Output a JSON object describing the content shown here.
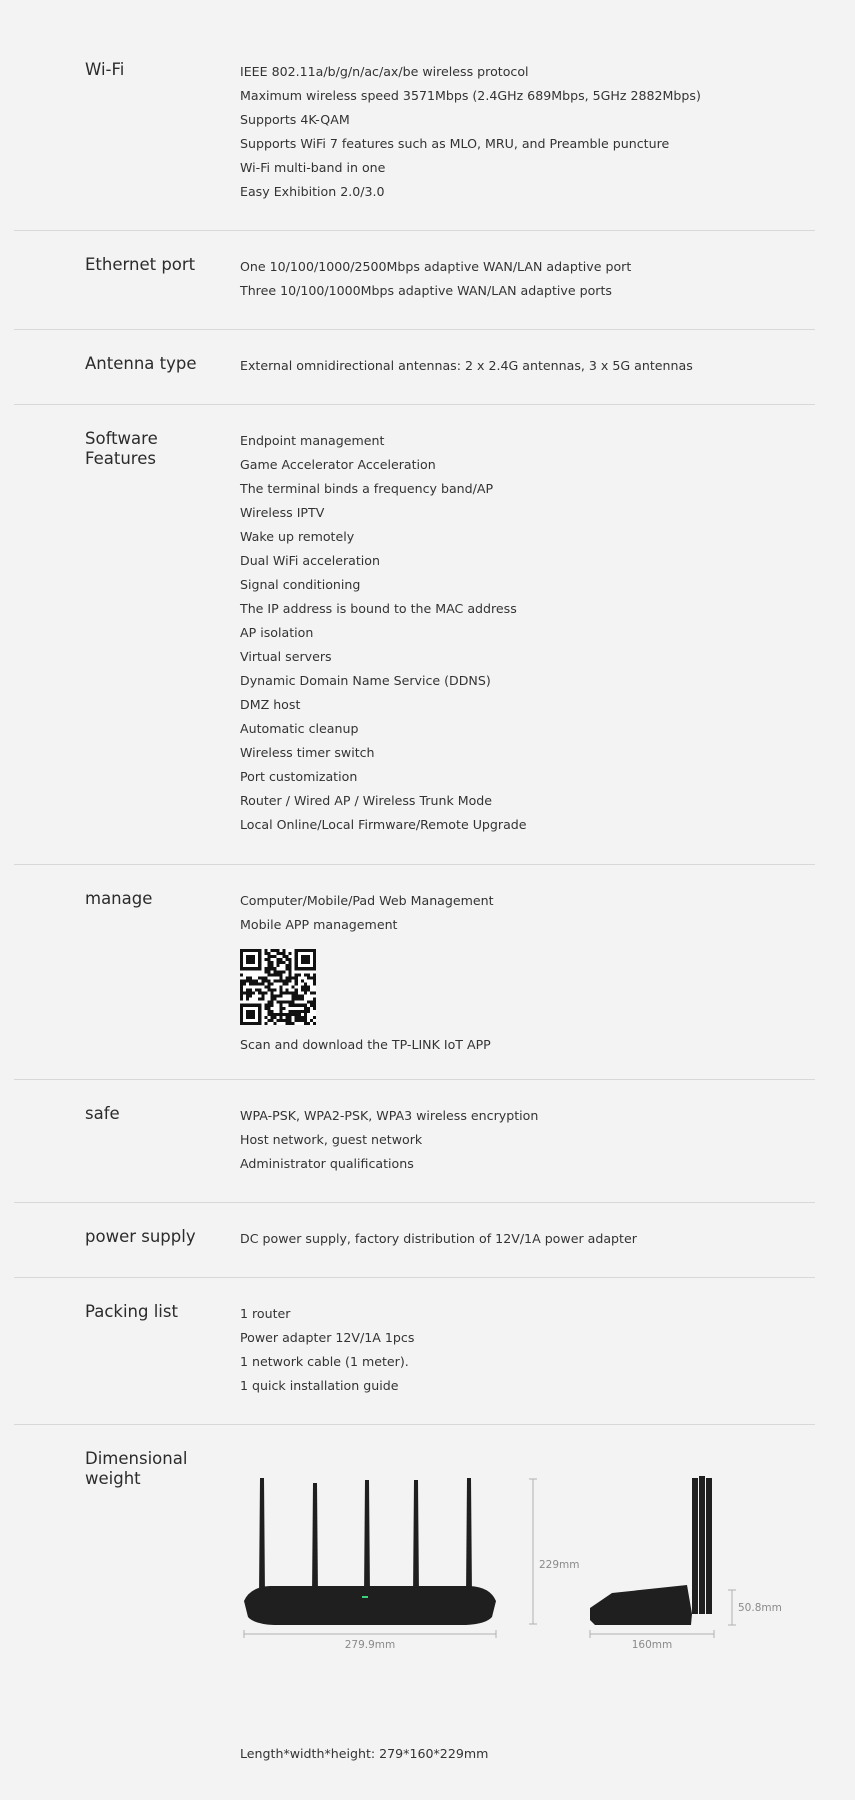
{
  "sections": {
    "wifi": {
      "label": "Wi-Fi",
      "items": [
        "IEEE 802.11a/b/g/n/ac/ax/be wireless protocol",
        "Maximum wireless speed 3571Mbps (2.4GHz 689Mbps, 5GHz 2882Mbps)",
        "Supports 4K-QAM",
        "Supports WiFi 7 features such as MLO, MRU, and Preamble puncture",
        "Wi-Fi multi-band in one",
        "Easy Exhibition 2.0/3.0"
      ]
    },
    "ethernet": {
      "label": "Ethernet port",
      "items": [
        "One 10/100/1000/2500Mbps adaptive WAN/LAN adaptive port",
        "Three 10/100/1000Mbps adaptive WAN/LAN adaptive ports"
      ]
    },
    "antenna": {
      "label": "Antenna type",
      "items": [
        "External omnidirectional antennas: 2 x 2.4G antennas, 3 x 5G antennas"
      ]
    },
    "software": {
      "label_line1": "Software",
      "label_line2": "Features",
      "items": [
        "Endpoint management",
        "Game Accelerator Acceleration",
        "The terminal binds a frequency band/AP",
        "Wireless IPTV",
        "Wake up remotely",
        "Dual WiFi acceleration",
        "Signal conditioning",
        "The IP address is bound to the MAC address",
        "AP isolation",
        "Virtual servers",
        "Dynamic Domain Name Service (DDNS)",
        "DMZ host",
        "Automatic cleanup",
        "Wireless timer switch",
        "Port customization",
        "Router / Wired AP / Wireless Trunk Mode",
        "Local Online/Local Firmware/Remote Upgrade"
      ]
    },
    "manage": {
      "label": "manage",
      "items": [
        "Computer/Mobile/Pad Web Management",
        "Mobile APP management"
      ],
      "qr_caption": "Scan and download the TP-LINK IoT APP"
    },
    "safe": {
      "label": "safe",
      "items": [
        "WPA-PSK, WPA2-PSK, WPA3 wireless encryption",
        "Host network, guest network",
        "Administrator qualifications"
      ]
    },
    "power": {
      "label": "power supply",
      "items": [
        "DC power supply, factory distribution of 12V/1A power adapter"
      ]
    },
    "packing": {
      "label": "Packing list",
      "items": [
        "1 router",
        "Power adapter 12V/1A 1pcs",
        "1 network cable (1 meter).",
        "1 quick installation guide"
      ]
    },
    "dimensions": {
      "label_line1": "Dimensional",
      "label_line2": "weight",
      "front_height": "229mm",
      "front_width": "279.9mm",
      "side_depth": "160mm",
      "side_height": "50.8mm",
      "summary": "Length*width*height: 279*160*229mm"
    }
  }
}
